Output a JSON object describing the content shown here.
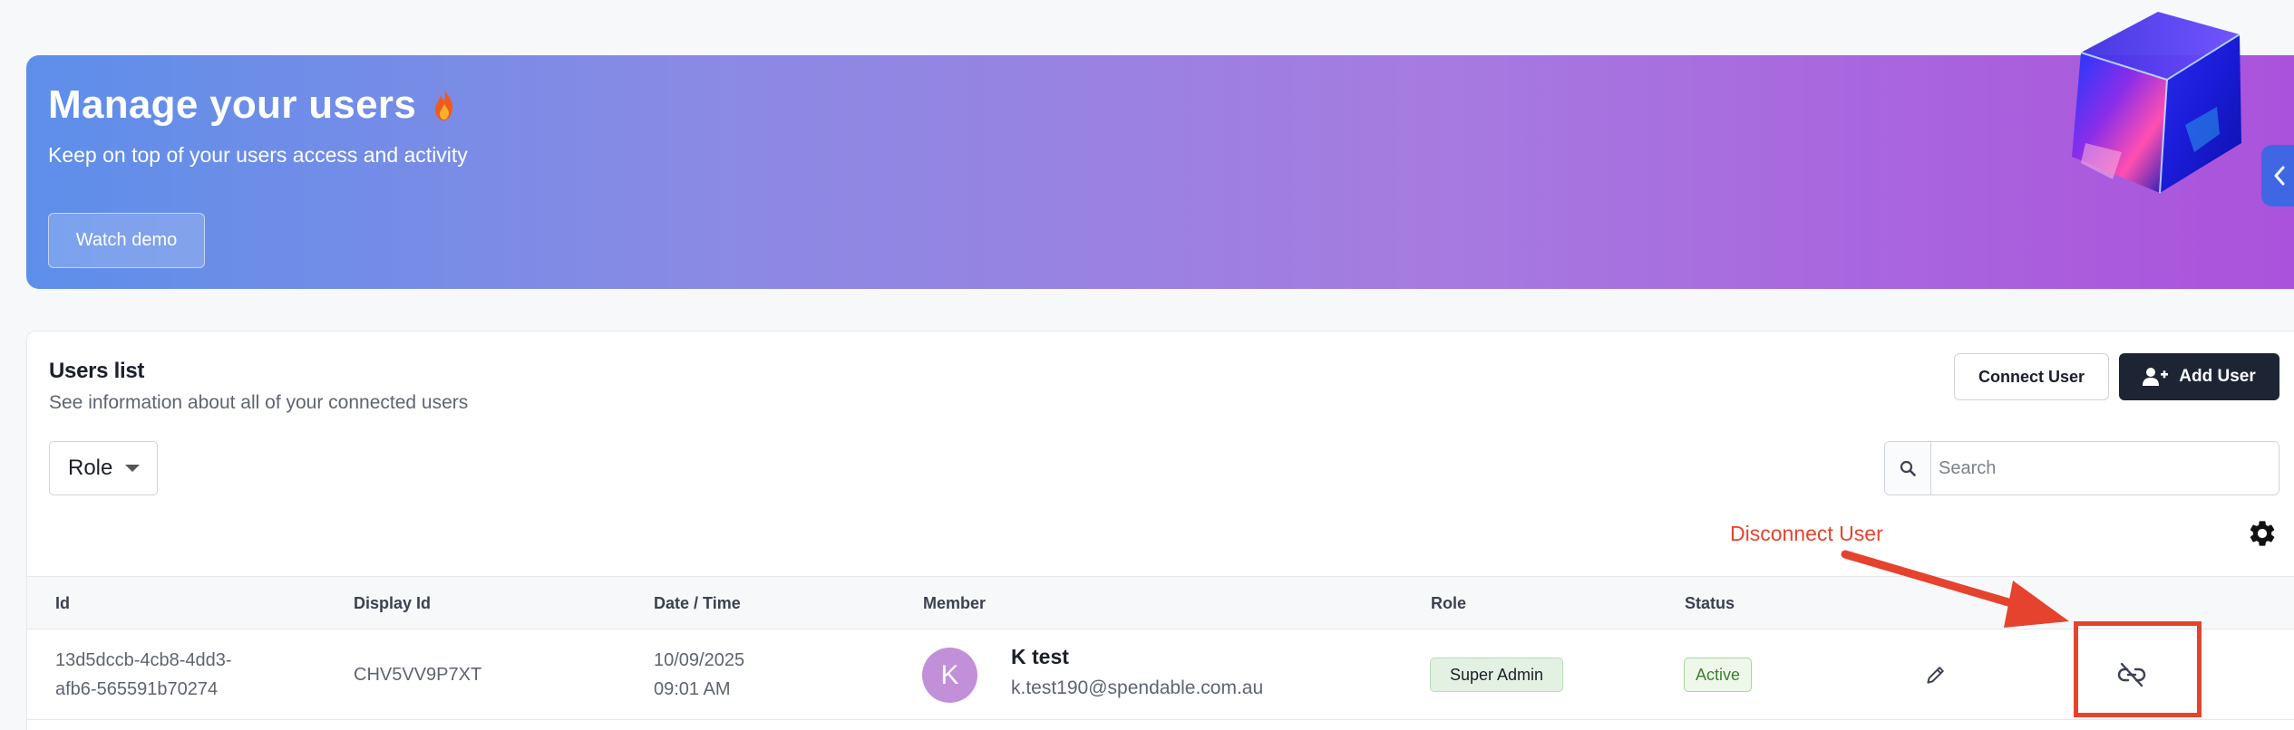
{
  "banner": {
    "title": "Manage your users",
    "subtitle": "Keep on top of your users access and activity",
    "watch_demo_label": "Watch demo"
  },
  "users_list": {
    "title": "Users list",
    "subtitle": "See information about all of your connected users",
    "connect_user_label": "Connect User",
    "add_user_label": "Add User",
    "role_filter_value": "Role",
    "search_placeholder": "Search"
  },
  "annotation": {
    "label": "Disconnect User",
    "color": "#e5432e"
  },
  "table": {
    "columns": [
      "Id",
      "Display Id",
      "Date / Time",
      "Member",
      "Role",
      "Status"
    ],
    "rows": [
      {
        "id_line1": "13d5dccb-4cb8-4dd3-",
        "id_line2": "afb6-565591b70274",
        "display_id": "CHV5VV9P7XT",
        "date": "10/09/2025",
        "time": "09:01 AM",
        "avatar_initial": "K",
        "member_name": "K test",
        "member_email": "k.test190@spendable.com.au",
        "role": "Super Admin",
        "status": "Active"
      }
    ]
  },
  "icons": [
    "fire-icon",
    "cube-illustration",
    "chevron-left-icon",
    "user-plus-icon",
    "search-icon",
    "gear-icon",
    "pencil-icon",
    "unlink-icon"
  ],
  "colors": {
    "banner_gradient_start": "#5d8fea",
    "banner_gradient_end": "#ab52dc",
    "primary_dark": "#1d2433",
    "side_tab": "#3f67e4",
    "avatar": "#c28fd9"
  }
}
